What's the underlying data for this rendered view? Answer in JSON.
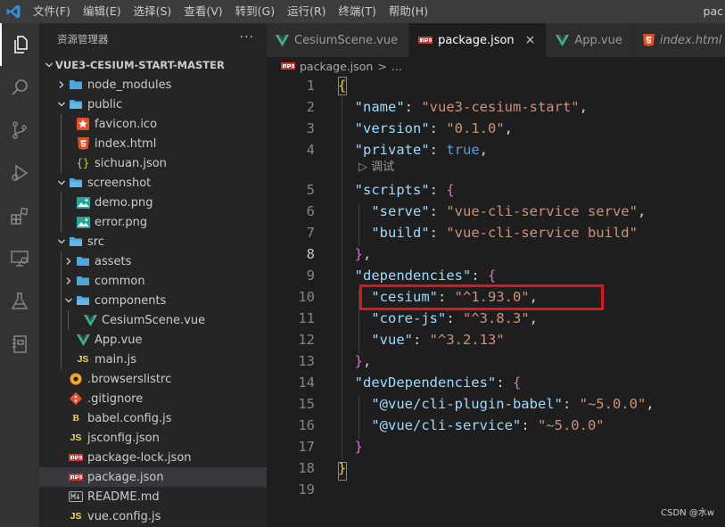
{
  "menu": {
    "items": [
      "文件(F)",
      "编辑(E)",
      "选择(S)",
      "查看(V)",
      "转到(G)",
      "运行(R)",
      "终端(T)",
      "帮助(H)"
    ],
    "title_fragment": "pac"
  },
  "activity": [
    "explorer-icon",
    "search-icon",
    "source-control-icon",
    "run-debug-icon",
    "extensions-icon",
    "remote-explorer-icon",
    "testing-icon",
    "notebook-icon"
  ],
  "explorer": {
    "header": "资源管理器",
    "more": "···",
    "section": "VUE3-CESIUM-START-MASTER",
    "tree": [
      {
        "label": "node_modules",
        "type": "folder",
        "state": "closed",
        "depth": 0
      },
      {
        "label": "public",
        "type": "folder",
        "state": "open",
        "depth": 0
      },
      {
        "label": "favicon.ico",
        "type": "ico",
        "depth": 1
      },
      {
        "label": "index.html",
        "type": "html",
        "depth": 1
      },
      {
        "label": "sichuan.json",
        "type": "json-braces",
        "depth": 1
      },
      {
        "label": "screenshot",
        "type": "folder",
        "state": "open",
        "depth": 0
      },
      {
        "label": "demo.png",
        "type": "image",
        "depth": 1
      },
      {
        "label": "error.png",
        "type": "image",
        "depth": 1
      },
      {
        "label": "src",
        "type": "folder",
        "state": "open",
        "depth": 0
      },
      {
        "label": "assets",
        "type": "folder",
        "state": "closed",
        "depth": 1
      },
      {
        "label": "common",
        "type": "folder",
        "state": "closed",
        "depth": 1
      },
      {
        "label": "components",
        "type": "folder",
        "state": "open",
        "depth": 1
      },
      {
        "label": "CesiumScene.vue",
        "type": "vue",
        "depth": 2
      },
      {
        "label": "App.vue",
        "type": "vue",
        "depth": 1
      },
      {
        "label": "main.js",
        "type": "js",
        "depth": 1
      },
      {
        "label": ".browserslistrc",
        "type": "browserslist",
        "depth": 0
      },
      {
        "label": ".gitignore",
        "type": "git",
        "depth": 0
      },
      {
        "label": "babel.config.js",
        "type": "babel",
        "depth": 0
      },
      {
        "label": "jsconfig.json",
        "type": "js",
        "depth": 0
      },
      {
        "label": "package-lock.json",
        "type": "npm",
        "depth": 0
      },
      {
        "label": "package.json",
        "type": "npm",
        "depth": 0,
        "selected": true
      },
      {
        "label": "README.md",
        "type": "md",
        "depth": 0
      },
      {
        "label": "vue.config.js",
        "type": "js",
        "depth": 0
      }
    ]
  },
  "tabs": [
    {
      "label": "CesiumScene.vue",
      "icon": "vue-icon",
      "active": false,
      "italic": false
    },
    {
      "label": "package.json",
      "icon": "npm-icon",
      "active": true,
      "italic": false,
      "close": "×"
    },
    {
      "label": "App.vue",
      "icon": "vue-icon",
      "active": false,
      "italic": false
    },
    {
      "label": "index.html",
      "icon": "html-icon",
      "active": false,
      "italic": true
    }
  ],
  "breadcrumb": {
    "file": "package.json",
    "sep": ">",
    "rest": "..."
  },
  "editor": {
    "codelens": "调试",
    "lines": [
      {
        "n": "1",
        "tokens": [
          {
            "t": "{",
            "c": "br1"
          }
        ]
      },
      {
        "n": "2",
        "tokens": [
          {
            "t": "  \"name\"",
            "c": "k"
          },
          {
            "t": ": ",
            "c": "p"
          },
          {
            "t": "\"vue3-cesium-start\"",
            "c": "s"
          },
          {
            "t": ",",
            "c": "p"
          }
        ]
      },
      {
        "n": "3",
        "tokens": [
          {
            "t": "  \"version\"",
            "c": "k"
          },
          {
            "t": ": ",
            "c": "p"
          },
          {
            "t": "\"0.1.0\"",
            "c": "s"
          },
          {
            "t": ",",
            "c": "p"
          }
        ]
      },
      {
        "n": "4",
        "tokens": [
          {
            "t": "  \"private\"",
            "c": "k"
          },
          {
            "t": ": ",
            "c": "p"
          },
          {
            "t": "true",
            "c": "b"
          },
          {
            "t": ",",
            "c": "p"
          }
        ]
      },
      {
        "n": "5",
        "tokens": [
          {
            "t": "  \"scripts\"",
            "c": "k"
          },
          {
            "t": ": ",
            "c": "p"
          },
          {
            "t": "{",
            "c": "br2"
          }
        ]
      },
      {
        "n": "6",
        "tokens": [
          {
            "t": "    \"serve\"",
            "c": "k"
          },
          {
            "t": ": ",
            "c": "p"
          },
          {
            "t": "\"vue-cli-service serve\"",
            "c": "s"
          },
          {
            "t": ",",
            "c": "p"
          }
        ]
      },
      {
        "n": "7",
        "tokens": [
          {
            "t": "    \"build\"",
            "c": "k"
          },
          {
            "t": ": ",
            "c": "p"
          },
          {
            "t": "\"vue-cli-service build\"",
            "c": "s"
          }
        ]
      },
      {
        "n": "8",
        "tokens": [
          {
            "t": "  }",
            "c": "br2"
          },
          {
            "t": ",",
            "c": "p"
          }
        ]
      },
      {
        "n": "9",
        "tokens": [
          {
            "t": "  \"dependencies\"",
            "c": "k"
          },
          {
            "t": ": ",
            "c": "p"
          },
          {
            "t": "{",
            "c": "br2"
          }
        ]
      },
      {
        "n": "10",
        "tokens": [
          {
            "t": "    \"cesium\"",
            "c": "k"
          },
          {
            "t": ": ",
            "c": "p"
          },
          {
            "t": "\"^1.93.0\"",
            "c": "s"
          },
          {
            "t": ",",
            "c": "p"
          }
        ]
      },
      {
        "n": "11",
        "tokens": [
          {
            "t": "    \"core-js\"",
            "c": "k"
          },
          {
            "t": ": ",
            "c": "p"
          },
          {
            "t": "\"^3.8.3\"",
            "c": "s"
          },
          {
            "t": ",",
            "c": "p"
          }
        ]
      },
      {
        "n": "12",
        "tokens": [
          {
            "t": "    \"vue\"",
            "c": "k"
          },
          {
            "t": ": ",
            "c": "p"
          },
          {
            "t": "\"^3.2.13\"",
            "c": "s"
          }
        ]
      },
      {
        "n": "13",
        "tokens": [
          {
            "t": "  }",
            "c": "br2"
          },
          {
            "t": ",",
            "c": "p"
          }
        ]
      },
      {
        "n": "14",
        "tokens": [
          {
            "t": "  \"devDependencies\"",
            "c": "k"
          },
          {
            "t": ": ",
            "c": "p"
          },
          {
            "t": "{",
            "c": "br2"
          }
        ]
      },
      {
        "n": "15",
        "tokens": [
          {
            "t": "    \"@vue/cli-plugin-babel\"",
            "c": "k"
          },
          {
            "t": ": ",
            "c": "p"
          },
          {
            "t": "\"~5.0.0\"",
            "c": "s"
          },
          {
            "t": ",",
            "c": "p"
          }
        ]
      },
      {
        "n": "16",
        "tokens": [
          {
            "t": "    \"@vue/cli-service\"",
            "c": "k"
          },
          {
            "t": ": ",
            "c": "p"
          },
          {
            "t": "\"~5.0.0\"",
            "c": "s"
          }
        ]
      },
      {
        "n": "17",
        "tokens": [
          {
            "t": "  }",
            "c": "br2"
          }
        ]
      },
      {
        "n": "18",
        "tokens": [
          {
            "t": "}",
            "c": "br1"
          }
        ]
      },
      {
        "n": "19",
        "tokens": []
      }
    ],
    "active_line": "8",
    "annotation_color": "#e0151b"
  },
  "watermark": "CSDN @水w",
  "colors": {
    "titlebar": "#3c3c3c",
    "activitybar": "#333333",
    "sidebar": "#252526",
    "editor": "#1e1e1e",
    "folder": "#4ea6dd",
    "vue": "#41b883",
    "html": "#e44d26",
    "json_braces": "#cbcb41",
    "js": "#f1dd3f",
    "npm": "#cb3837",
    "image": "#26a69a",
    "favicon": "#e44d26"
  }
}
